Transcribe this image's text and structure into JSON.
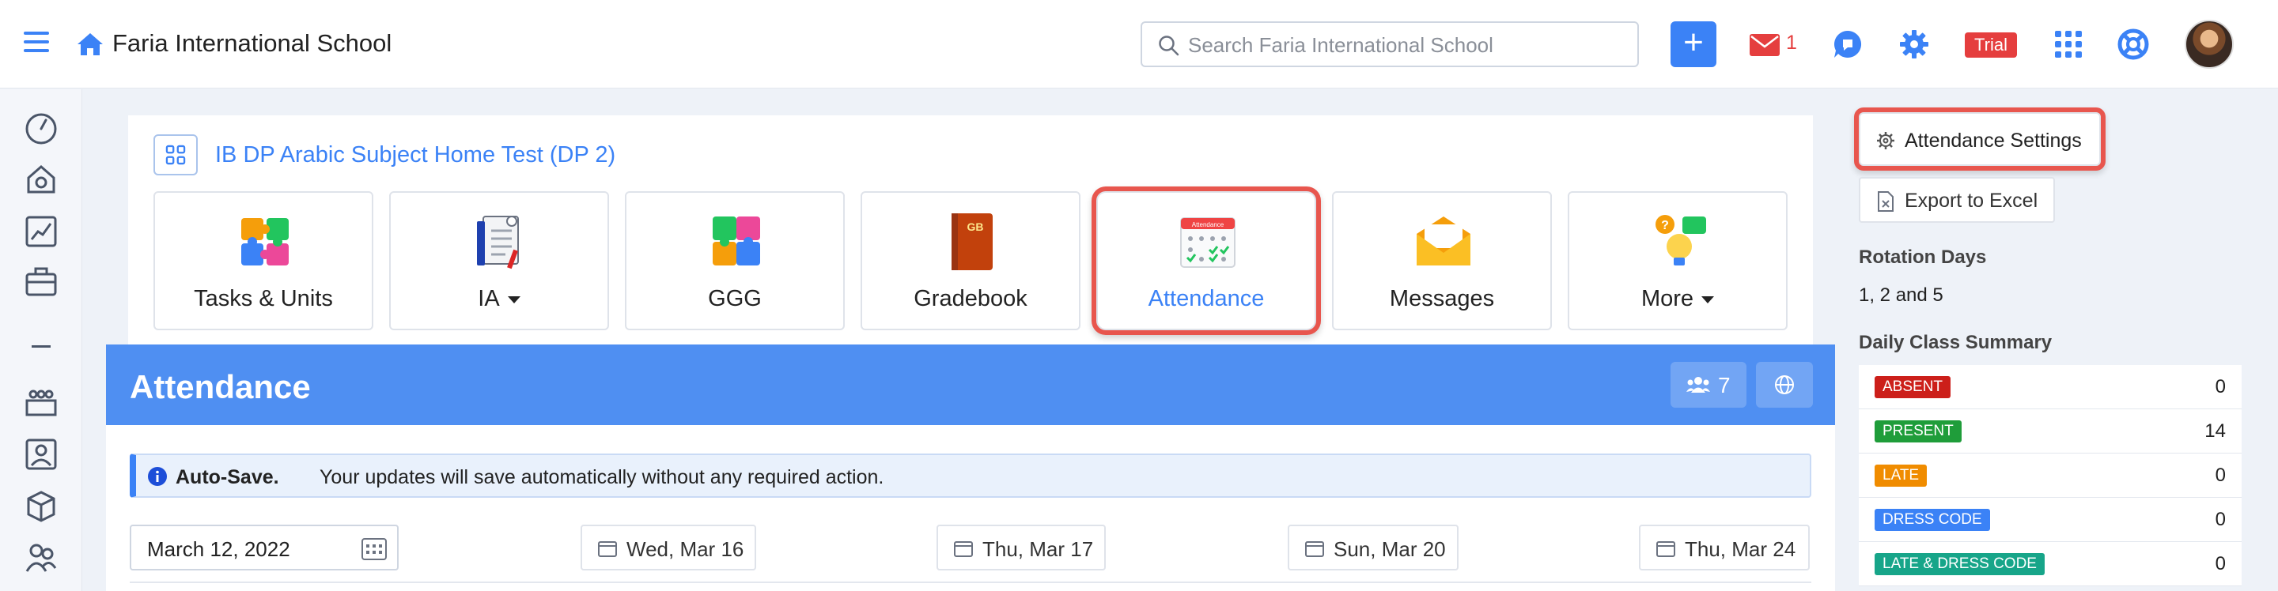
{
  "header": {
    "school_name": "Faria International School",
    "search_placeholder": "Search Faria International School",
    "plus_label": "+",
    "mail_count": "1",
    "trial_label": "Trial"
  },
  "sidebar": {
    "icons": [
      "dashboard-icon",
      "home-icon",
      "chart-icon",
      "briefcase-icon",
      "divider",
      "classes-icon",
      "teacher-icon",
      "cube-icon",
      "users-icon"
    ]
  },
  "class": {
    "title": "IB DP Arabic Subject Home Test (DP 2)"
  },
  "tiles": [
    {
      "label": "Tasks & Units",
      "caret": false,
      "active": false
    },
    {
      "label": "IA",
      "caret": true,
      "active": false
    },
    {
      "label": "GGG",
      "caret": false,
      "active": false
    },
    {
      "label": "Gradebook",
      "caret": false,
      "active": false,
      "icon_text": "GB"
    },
    {
      "label": "Attendance",
      "caret": false,
      "active": true,
      "icon_text": "Attendance"
    },
    {
      "label": "Messages",
      "caret": false,
      "active": false
    },
    {
      "label": "More",
      "caret": true,
      "active": false
    }
  ],
  "attendance": {
    "title": "Attendance",
    "people_count": "7",
    "autosave_bold": "Auto-Save.",
    "autosave_text": "Your updates will save automatically without any required action.",
    "date_value": "March 12, 2022",
    "days": [
      "Wed, Mar 16",
      "Thu, Mar 17",
      "Sun, Mar 20",
      "Thu, Mar 24"
    ]
  },
  "right_panel": {
    "settings_label": "Attendance Settings",
    "export_label": "Export to Excel",
    "rotation_title": "Rotation Days",
    "rotation_value": "1, 2 and 5",
    "summary_title": "Daily Class Summary",
    "summary": [
      {
        "label": "ABSENT",
        "count": "0",
        "color": "#cc1f1a"
      },
      {
        "label": "PRESENT",
        "count": "14",
        "color": "#1f9d3a"
      },
      {
        "label": "LATE",
        "count": "0",
        "color": "#f08c00"
      },
      {
        "label": "DRESS CODE",
        "count": "0",
        "color": "#3b82f6"
      },
      {
        "label": "LATE & DRESS CODE",
        "count": "0",
        "color": "#17a589"
      }
    ]
  },
  "colors": {
    "accent": "#3b82f6",
    "attendance_header": "#4f8ff2",
    "highlight": "#e8564e"
  }
}
